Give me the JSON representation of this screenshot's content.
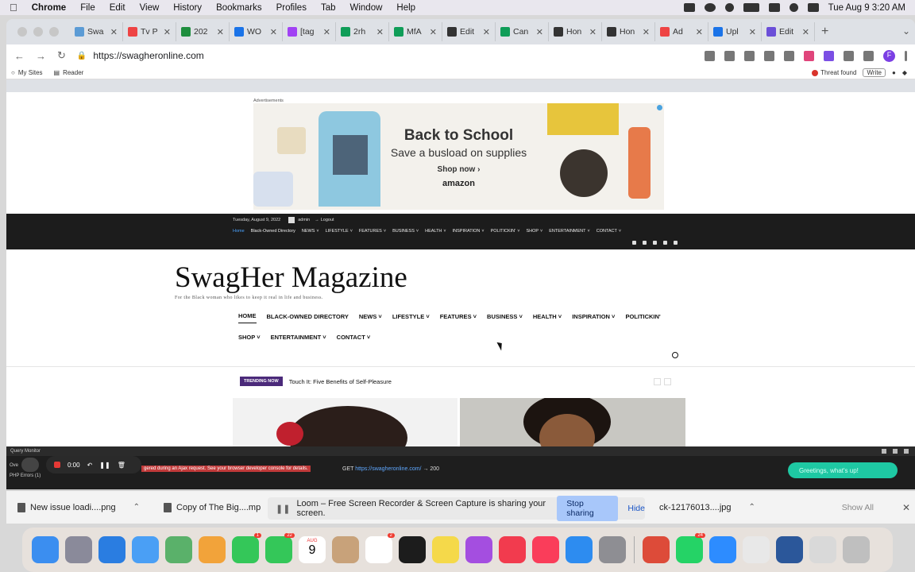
{
  "menubar": {
    "app": "Chrome",
    "items": [
      "File",
      "Edit",
      "View",
      "History",
      "Bookmarks",
      "Profiles",
      "Tab",
      "Window",
      "Help"
    ],
    "clock": "Tue Aug 9  3:20 AM"
  },
  "tabs": [
    {
      "label": "Swa",
      "color": "#5b9bd5"
    },
    {
      "label": "Tv P",
      "color": "#e44"
    },
    {
      "label": "202",
      "color": "#1e8e3e"
    },
    {
      "label": "WO",
      "color": "#1a73e8"
    },
    {
      "label": "[tag",
      "color": "#a142f4"
    },
    {
      "label": "2rh",
      "color": "#0f9d58"
    },
    {
      "label": "MfA",
      "color": "#0f9d58"
    },
    {
      "label": "Edit",
      "color": "#333"
    },
    {
      "label": "Can",
      "color": "#0f9d58"
    },
    {
      "label": "Hon",
      "color": "#333"
    },
    {
      "label": "Hon",
      "color": "#333"
    },
    {
      "label": "Ad",
      "color": "#e44"
    },
    {
      "label": "Upl",
      "color": "#1a73e8"
    },
    {
      "label": "Edit",
      "color": "#6b4fd8"
    }
  ],
  "toolbar": {
    "url": "https://swagheronline.com",
    "profile_initial": "F"
  },
  "adminbar": {
    "my_sites": "My Sites",
    "reader": "Reader",
    "threat": "Threat found",
    "write": "Write"
  },
  "ad": {
    "label": "Advertisements",
    "title": "Back to School",
    "subtitle": "Save a busload on supplies",
    "cta": "Shop now ›",
    "brand": "amazon"
  },
  "topbar": {
    "date": "Tuesday, August 9, 2022",
    "user": "admin",
    "logout": "Logout",
    "menu": [
      "Home",
      "Black-Owned Directory",
      "NEWS",
      "LIFESTYLE",
      "FEATURES",
      "BUSINESS",
      "HEALTH",
      "INSPIRATION",
      "POLITICKIN'",
      "SHOP",
      "ENTERTAINMENT",
      "CONTACT"
    ]
  },
  "site": {
    "title": "SwagHer Magazine",
    "tagline": "For the Black woman who likes to keep it real in life and business."
  },
  "mainnav": {
    "row1": [
      "HOME",
      "BLACK-OWNED DIRECTORY",
      "NEWS",
      "LIFESTYLE",
      "FEATURES",
      "BUSINESS",
      "HEALTH",
      "INSPIRATION",
      "POLITICKIN'"
    ],
    "row2": [
      "SHOP",
      "ENTERTAINMENT",
      "CONTACT"
    ],
    "dropdowns": [
      "NEWS",
      "LIFESTYLE",
      "FEATURES",
      "BUSINESS",
      "HEALTH",
      "INSPIRATION",
      "SHOP",
      "ENTERTAINMENT",
      "CONTACT"
    ]
  },
  "trending": {
    "badge": "TRENDING NOW",
    "headline": "Touch It: Five Benefits of Self-Pleasure"
  },
  "querymonitor": {
    "title": "Query Monitor",
    "side1": "Ove",
    "side2": "PHP Errors (1)",
    "error": "gered during an Ajax request. See your browser developer console for details.",
    "get_prefix": "GET",
    "get_url": "https://swagheronline.com/",
    "get_suffix": "→ 200"
  },
  "loom": {
    "timer": "0:00",
    "share_text": "Loom – Free Screen Recorder & Screen Capture is sharing your screen.",
    "stop": "Stop sharing",
    "hide": "Hide",
    "pill": "Greetings, what's up!"
  },
  "downloads": {
    "items": [
      "New issue loadi....png",
      "Copy of The Big....mp",
      "ck-12176013....jpg"
    ],
    "show_all": "Show All"
  },
  "dock": {
    "apps": [
      {
        "name": "Finder",
        "color": "#3b8ef0",
        "badge": ""
      },
      {
        "name": "Launchpad",
        "color": "#8a8a9a",
        "badge": ""
      },
      {
        "name": "Safari",
        "color": "#2a7de1",
        "badge": ""
      },
      {
        "name": "Mail",
        "color": "#4a9ff5",
        "badge": ""
      },
      {
        "name": "Maps",
        "color": "#5ab16a",
        "badge": ""
      },
      {
        "name": "Photos",
        "color": "#f2a33a",
        "badge": ""
      },
      {
        "name": "FaceTime",
        "color": "#34c759",
        "badge": "1"
      },
      {
        "name": "Messages",
        "color": "#34c759",
        "badge": "22"
      },
      {
        "name": "Calendar",
        "color": "#ffffff",
        "badge": ""
      },
      {
        "name": "Contacts",
        "color": "#c8a27a",
        "badge": ""
      },
      {
        "name": "Reminders",
        "color": "#ffffff",
        "badge": "2"
      },
      {
        "name": "TV",
        "color": "#1c1c1c",
        "badge": ""
      },
      {
        "name": "Notes",
        "color": "#f5d94a",
        "badge": ""
      },
      {
        "name": "Podcasts",
        "color": "#a44ee0",
        "badge": ""
      },
      {
        "name": "News",
        "color": "#f23b4e",
        "badge": ""
      },
      {
        "name": "Music",
        "color": "#fa3d5a",
        "badge": ""
      },
      {
        "name": "App Store",
        "color": "#2d8cf0",
        "badge": ""
      },
      {
        "name": "System Preferences",
        "color": "#8e8e93",
        "badge": ""
      },
      {
        "name": "Chrome",
        "color": "#dd4b39",
        "badge": ""
      },
      {
        "name": "WhatsApp",
        "color": "#25d366",
        "badge": "24"
      },
      {
        "name": "Zoom",
        "color": "#2d8cff",
        "badge": ""
      },
      {
        "name": "TextEdit",
        "color": "#e8e8e8",
        "badge": ""
      },
      {
        "name": "Word",
        "color": "#2b579a",
        "badge": ""
      },
      {
        "name": "Downloads",
        "color": "#d9d9d9",
        "badge": ""
      },
      {
        "name": "Trash",
        "color": "#bfbfbf",
        "badge": ""
      }
    ],
    "calendar_month": "AUG",
    "calendar_day": "9"
  }
}
